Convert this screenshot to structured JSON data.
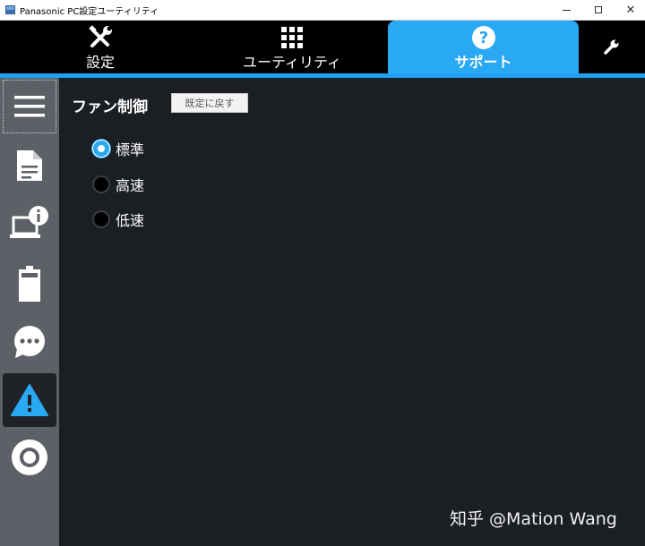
{
  "window": {
    "title": "Panasonic PC設定ユーティリティ",
    "controls": {
      "minimize": "minimize-icon",
      "maximize": "maximize-icon",
      "close": "✕"
    }
  },
  "tabs": [
    {
      "label": "設定",
      "icon": "tools-icon",
      "active": false
    },
    {
      "label": "ユーティリティ",
      "icon": "grid-icon",
      "active": false
    },
    {
      "label": "サポート",
      "icon": "help-circle-icon",
      "active": true
    }
  ],
  "toolbar": {
    "wrench_icon": "wrench-icon"
  },
  "sidebar": {
    "items": [
      {
        "icon": "hamburger-menu-icon",
        "focused": true
      },
      {
        "icon": "document-icon"
      },
      {
        "icon": "laptop-info-icon"
      },
      {
        "icon": "battery-icon"
      },
      {
        "icon": "chat-bubble-icon"
      },
      {
        "icon": "warning-icon",
        "active": true
      },
      {
        "icon": "target-icon"
      }
    ]
  },
  "main": {
    "title": "ファン制御",
    "reset_label": "既定に戻す",
    "options": [
      {
        "label": "標準",
        "checked": true
      },
      {
        "label": "高速",
        "checked": false
      },
      {
        "label": "低速",
        "checked": false
      }
    ]
  },
  "watermark": "知乎 @Mation Wang",
  "colors": {
    "accent": "#29a8f3",
    "background": "#1b1e22",
    "sidebar": "#5d6066",
    "topbar": "#000000"
  }
}
